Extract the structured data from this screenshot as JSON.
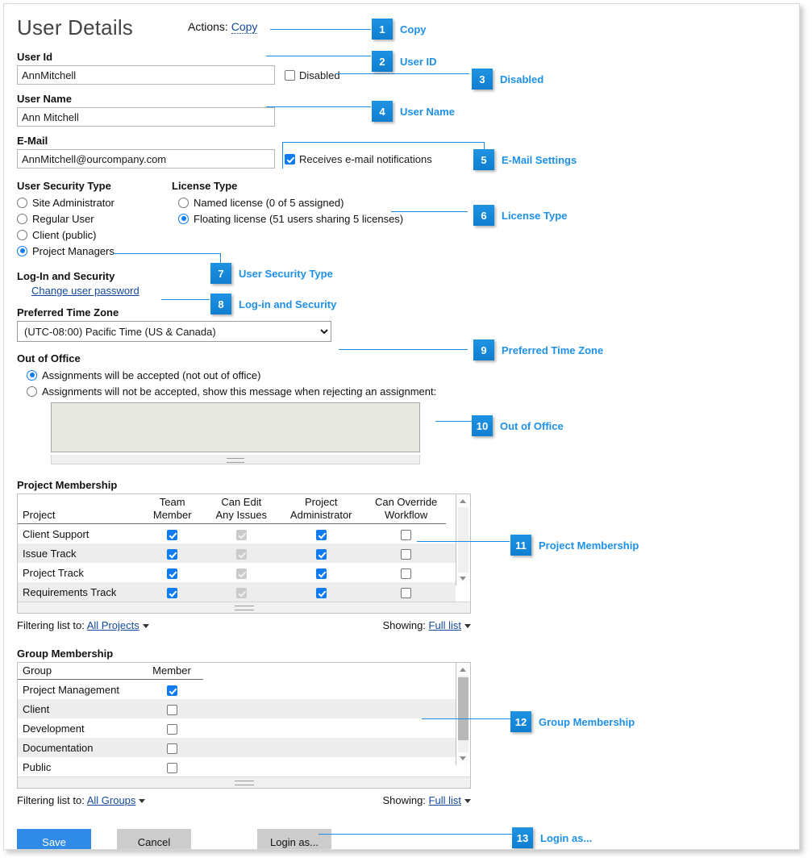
{
  "page": {
    "title": "User Details",
    "actions_label": "Actions:",
    "actions_copy": "Copy"
  },
  "fields": {
    "user_id_label": "User Id",
    "user_id_value": "AnnMitchell",
    "disabled_label": "Disabled",
    "disabled_checked": false,
    "user_name_label": "User Name",
    "user_name_value": "Ann Mitchell",
    "email_label": "E-Mail",
    "email_value": "AnnMitchell@ourcompany.com",
    "email_notify_label": "Receives e-mail notifications",
    "email_notify_checked": true
  },
  "security_type": {
    "heading": "User Security Type",
    "options": [
      {
        "label": "Site Administrator",
        "selected": false
      },
      {
        "label": "Regular User",
        "selected": false
      },
      {
        "label": "Client (public)",
        "selected": false
      },
      {
        "label": "Project Managers",
        "selected": true
      }
    ]
  },
  "license_type": {
    "heading": "License Type",
    "options": [
      {
        "label": "Named license (0 of 5 assigned)",
        "selected": false
      },
      {
        "label": "Floating license (51 users sharing 5 licenses)",
        "selected": true
      }
    ]
  },
  "login_security": {
    "heading": "Log-In and Security",
    "change_password_link": "Change user password"
  },
  "time_zone": {
    "heading": "Preferred Time Zone",
    "selected": "(UTC-08:00) Pacific Time (US & Canada)"
  },
  "out_of_office": {
    "heading": "Out of Office",
    "options": [
      {
        "label": "Assignments will be accepted (not out of office)",
        "selected": true
      },
      {
        "label": "Assignments will not be accepted, show this message when rejecting an assignment:",
        "selected": false
      }
    ],
    "message_value": ""
  },
  "project_membership": {
    "heading": "Project Membership",
    "columns": [
      "Project",
      "Team Member",
      "Can Edit Any Issues",
      "Project Administrator",
      "Can Override Workflow"
    ],
    "rows": [
      {
        "project": "Client Support",
        "team_member": "checked",
        "can_edit": "disabled-checked",
        "project_admin": "checked",
        "can_override": "unchecked"
      },
      {
        "project": "Issue Track",
        "team_member": "checked",
        "can_edit": "disabled-checked",
        "project_admin": "checked",
        "can_override": "unchecked"
      },
      {
        "project": "Project Track",
        "team_member": "checked",
        "can_edit": "disabled-checked",
        "project_admin": "checked",
        "can_override": "unchecked"
      },
      {
        "project": "Requirements Track",
        "team_member": "checked",
        "can_edit": "disabled-checked",
        "project_admin": "checked",
        "can_override": "unchecked"
      }
    ],
    "filter_label": "Filtering list to:",
    "filter_value": "All Projects",
    "showing_label": "Showing:",
    "showing_value": "Full list"
  },
  "group_membership": {
    "heading": "Group Membership",
    "columns": [
      "Group",
      "Member"
    ],
    "rows": [
      {
        "group": "Project Management",
        "member": "checked"
      },
      {
        "group": "Client",
        "member": "unchecked"
      },
      {
        "group": "Development",
        "member": "unchecked"
      },
      {
        "group": "Documentation",
        "member": "unchecked"
      },
      {
        "group": "Public",
        "member": "unchecked"
      }
    ],
    "filter_label": "Filtering list to:",
    "filter_value": "All Groups",
    "showing_label": "Showing:",
    "showing_value": "Full list"
  },
  "buttons": {
    "save": "Save",
    "cancel": "Cancel",
    "login_as": "Login as..."
  },
  "callouts": [
    {
      "num": "1",
      "label": "Copy"
    },
    {
      "num": "2",
      "label": "User ID"
    },
    {
      "num": "3",
      "label": "Disabled"
    },
    {
      "num": "4",
      "label": "User Name"
    },
    {
      "num": "5",
      "label": "E-Mail Settings"
    },
    {
      "num": "6",
      "label": "License Type"
    },
    {
      "num": "7",
      "label": "User Security Type"
    },
    {
      "num": "8",
      "label": "Log-in and Security"
    },
    {
      "num": "9",
      "label": "Preferred Time Zone"
    },
    {
      "num": "10",
      "label": "Out of Office"
    },
    {
      "num": "11",
      "label": "Project Membership"
    },
    {
      "num": "12",
      "label": "Group Membership"
    },
    {
      "num": "13",
      "label": "Login as..."
    }
  ],
  "colors": {
    "accent_blue": "#1e90e8",
    "badge_blue": "#0f7ed0",
    "save_blue": "#2f8ae8",
    "link_blue": "#14499e",
    "checkbox_blue": "#0d7cf2"
  }
}
